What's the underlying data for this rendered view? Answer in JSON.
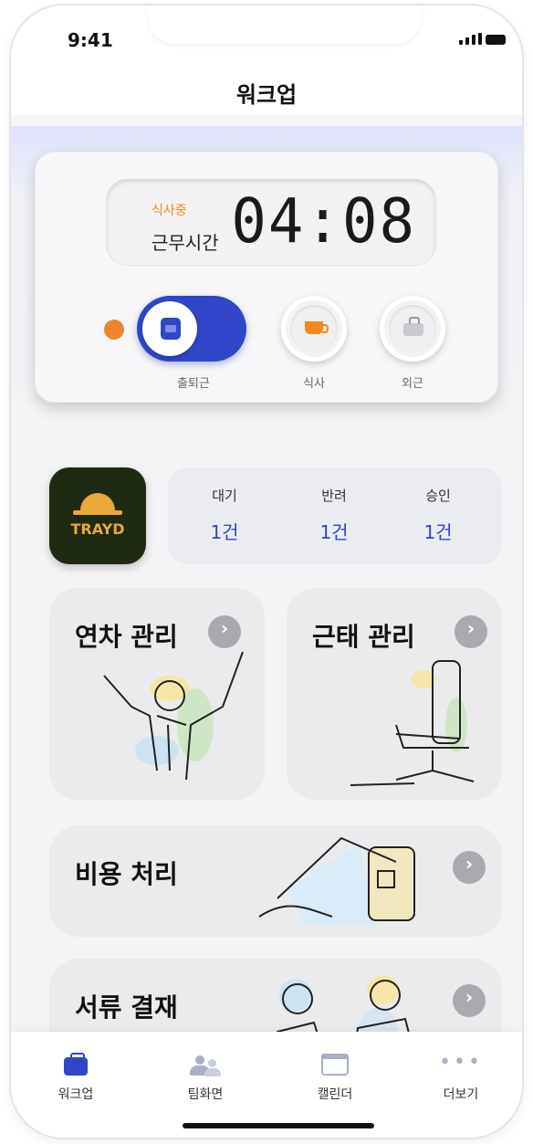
{
  "status_bar": {
    "time": "9:41"
  },
  "header": {
    "title": "워크업"
  },
  "timer": {
    "status": "식사중",
    "label": "근무시간",
    "clock": "04:08"
  },
  "attendance_buttons": [
    {
      "label": "출퇴근",
      "icon": "briefcase-icon",
      "active": true
    },
    {
      "label": "식사",
      "icon": "coffee-cup-icon"
    },
    {
      "label": "외근",
      "icon": "bag-icon"
    }
  ],
  "brand": {
    "logo_text": "TRAYD"
  },
  "approvals": [
    {
      "label": "대기",
      "value": "1건"
    },
    {
      "label": "반려",
      "value": "1건"
    },
    {
      "label": "승인",
      "value": "1건"
    }
  ],
  "cards": {
    "leave": "연차 관리",
    "attendance": "근태 관리",
    "expense": "비용 처리",
    "documents": "서류 결재"
  },
  "tabs": [
    {
      "label": "워크업",
      "icon": "briefcase-icon",
      "active": true
    },
    {
      "label": "팀화면",
      "icon": "team-icon"
    },
    {
      "label": "캘린더",
      "icon": "calendar-icon"
    },
    {
      "label": "더보기",
      "icon": "more-icon"
    }
  ],
  "colors": {
    "accent": "#2f46c9",
    "orange": "#f08a1a",
    "brand_bg": "#1f2a12"
  }
}
